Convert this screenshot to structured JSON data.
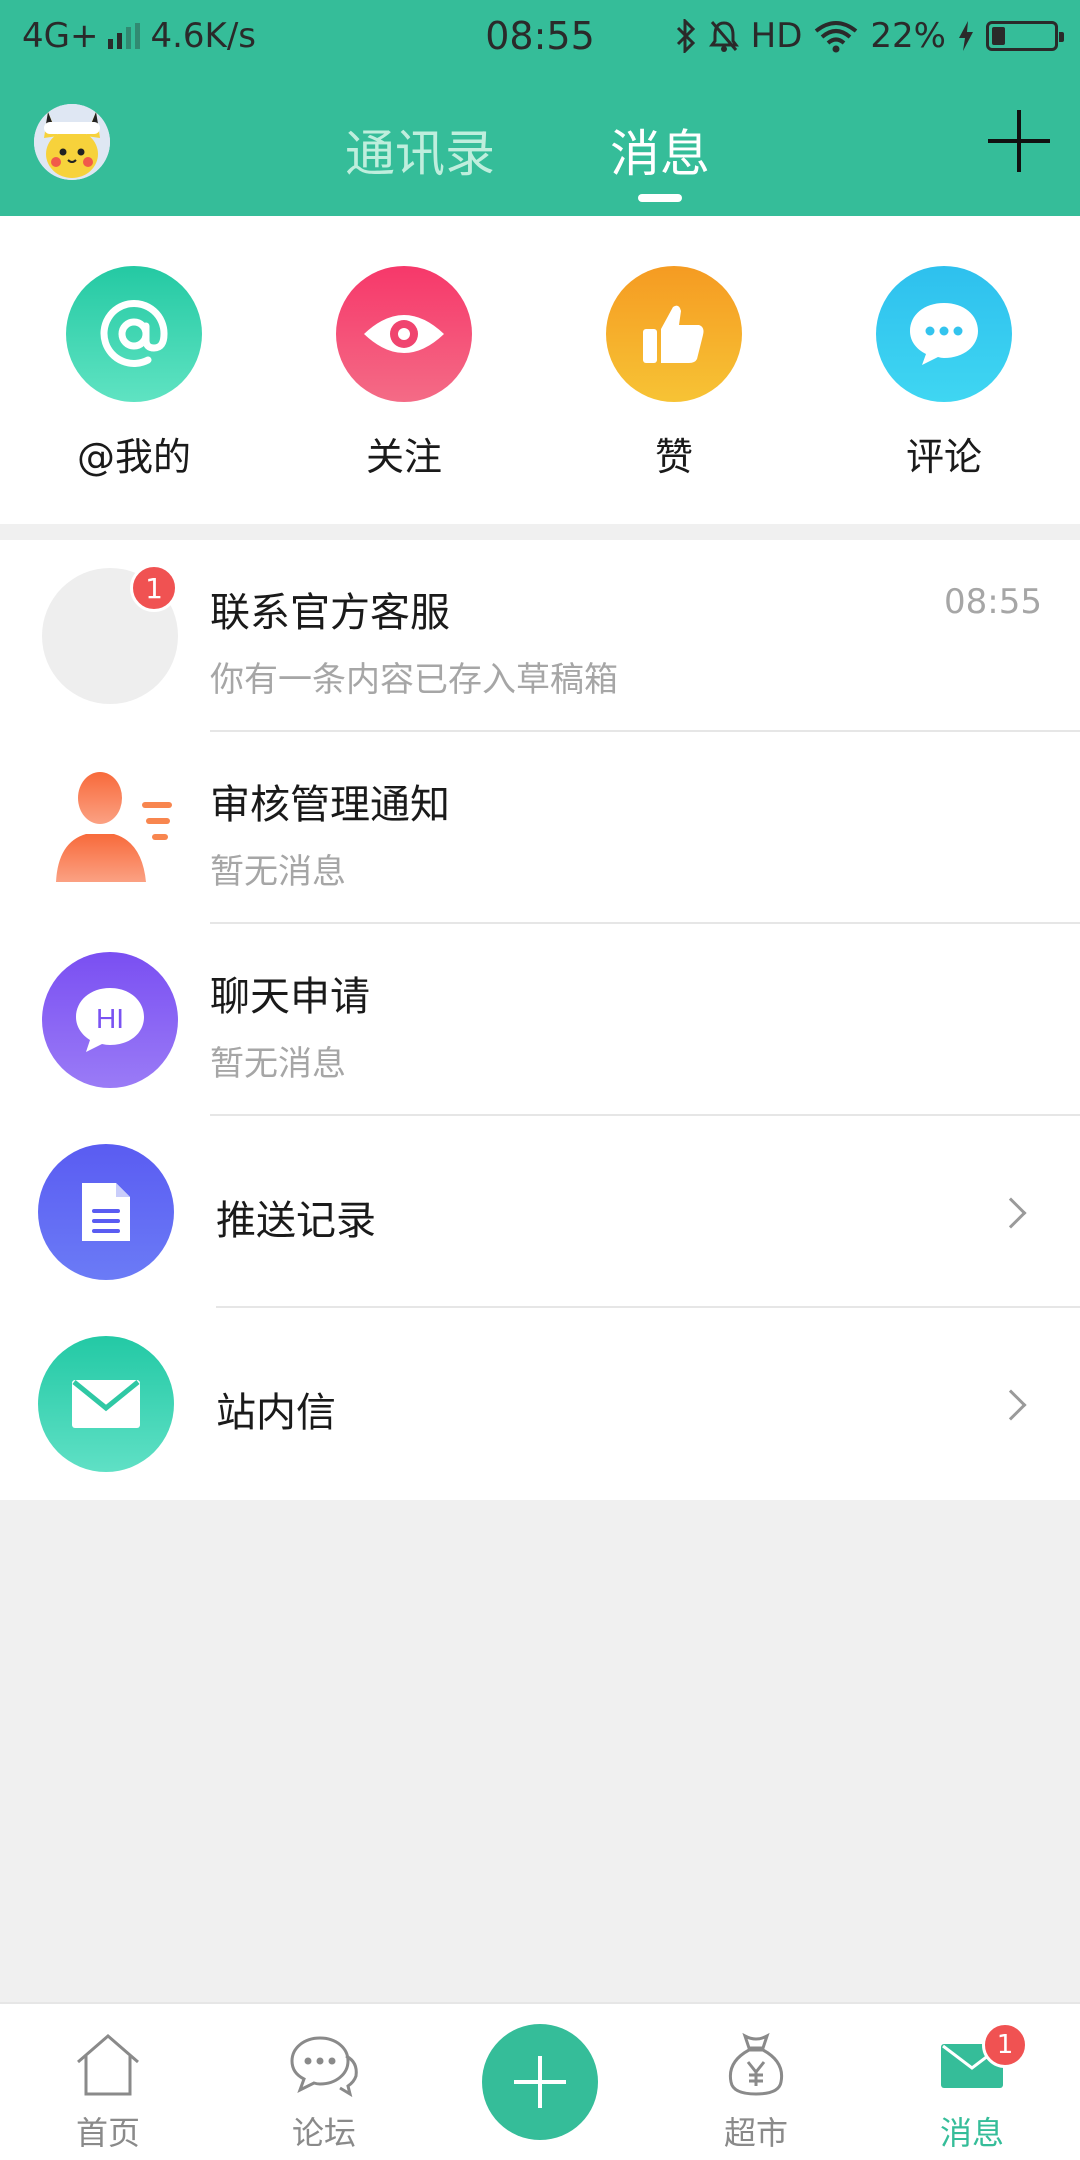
{
  "status_bar": {
    "network": "4G+",
    "speed": "4.6K/s",
    "time": "08:55",
    "hd": "HD",
    "battery_percent": "22%",
    "battery_level": 0.22
  },
  "header": {
    "tabs": [
      {
        "label": "通讯录",
        "active": false
      },
      {
        "label": "消息",
        "active": true
      }
    ],
    "add_icon": "plus-icon"
  },
  "quick_actions": [
    {
      "label": "@我的",
      "icon": "at-icon",
      "color": "#30cfa6"
    },
    {
      "label": "关注",
      "icon": "eye-icon",
      "color": "#f0446f"
    },
    {
      "label": "赞",
      "icon": "thumbs-up-icon",
      "color": "#f5a31e"
    },
    {
      "label": "评论",
      "icon": "chat-bubble-icon",
      "color": "#33c4ee"
    }
  ],
  "messages": [
    {
      "title": "联系官方客服",
      "subtitle": "你有一条内容已存入草稿箱",
      "time": "08:55",
      "badge": "1"
    },
    {
      "title": "审核管理通知",
      "subtitle": "暂无消息"
    },
    {
      "title": "聊天申请",
      "subtitle": "暂无消息",
      "icon_text": "HI"
    }
  ],
  "links": [
    {
      "title": "推送记录",
      "icon": "document-icon"
    },
    {
      "title": "站内信",
      "icon": "envelope-icon"
    }
  ],
  "bottom_nav": {
    "items": [
      {
        "label": "首页",
        "icon": "home-icon"
      },
      {
        "label": "论坛",
        "icon": "forum-icon"
      },
      {
        "label": "超市",
        "icon": "money-bag-icon"
      },
      {
        "label": "消息",
        "icon": "mail-icon",
        "active": true,
        "badge": "1"
      }
    ],
    "center_icon": "plus-icon",
    "accent": "#35bd99"
  }
}
